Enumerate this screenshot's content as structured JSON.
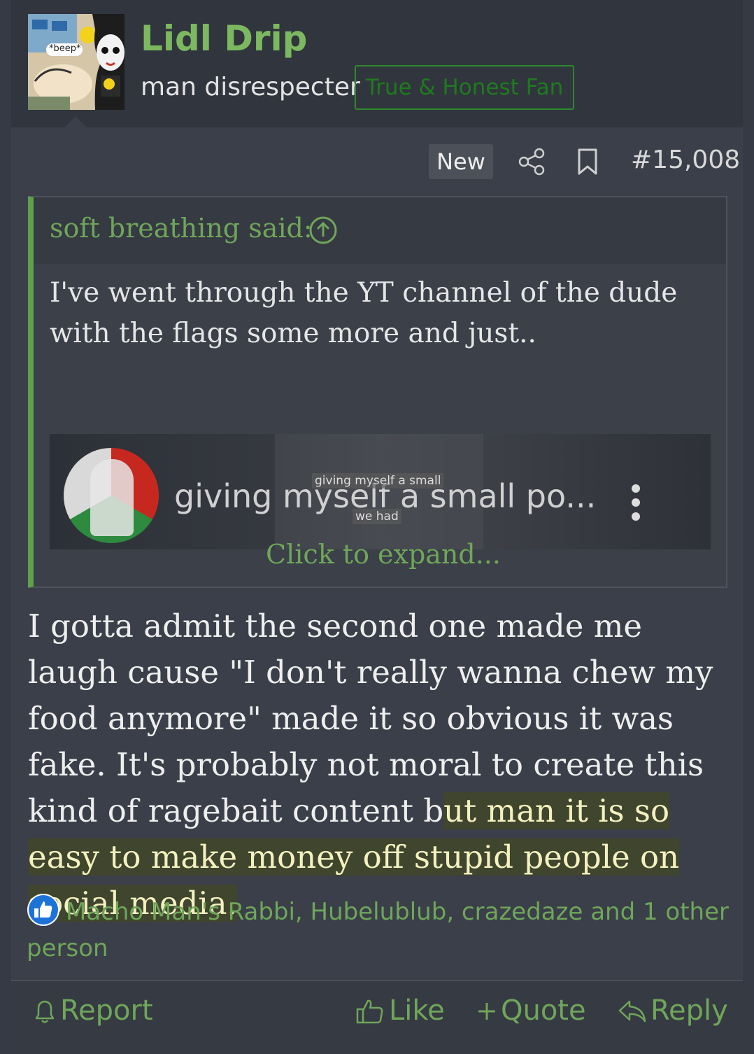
{
  "user": {
    "name": "Lidl Drip",
    "title": "man disrespecter",
    "banner": "True & Honest Fan",
    "avatar_text": "*beep*"
  },
  "post_meta": {
    "new_label": "New",
    "post_number": "#15,008"
  },
  "quote": {
    "author_label": "soft breathing said:",
    "text": "I've went through the YT channel of the dude with the flags some more and just..",
    "video_title": "giving myself a small po...",
    "video_caption_top": "giving myself a small",
    "video_caption_bottom": "we had",
    "expand_label": "Click to expand..."
  },
  "post_body": {
    "text_plain": "I gotta admit the second one made me laugh cause \"I don't really wanna chew my food anymore\" made it so obvious it was fake. It's probably not moral to create this kind of ragebait content b",
    "text_highlighted": "ut man it is so easy to make money off stupid people on social media."
  },
  "reactions": {
    "text": "Macho Man's Rabbi, Hubelublub, crazedaze and 1 other person"
  },
  "footer": {
    "report": "Report",
    "like": "Like",
    "quote": "Quote",
    "reply": "Reply"
  },
  "colors": {
    "accent_green": "#6fa65a",
    "username_green": "#7cb860",
    "background": "#3a3f49"
  }
}
